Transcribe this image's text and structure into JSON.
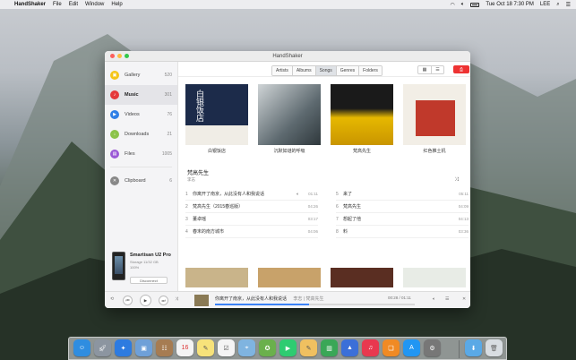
{
  "menubar": {
    "app_name": "HandShaker",
    "items": [
      "File",
      "Edit",
      "Window",
      "Help"
    ],
    "clock": "Tue Oct 18 7:30 PM",
    "user": "LEE"
  },
  "window": {
    "title": "HandShaker"
  },
  "sidebar": {
    "items": [
      {
        "label": "Gallery",
        "count": "520",
        "color": "#f5c518",
        "icon": "gallery-icon"
      },
      {
        "label": "Music",
        "count": "301",
        "color": "#e5383b",
        "icon": "music-icon"
      },
      {
        "label": "Videos",
        "count": "76",
        "color": "#2f7fe6",
        "icon": "video-icon"
      },
      {
        "label": "Downloads",
        "count": "21",
        "color": "#8bc34a",
        "icon": "download-icon"
      },
      {
        "label": "Files",
        "count": "1005",
        "color": "#9b59d6",
        "icon": "file-icon"
      },
      {
        "label": "Clipboard",
        "count": "6",
        "color": "#888888",
        "icon": "clipboard-icon"
      }
    ],
    "device": {
      "name": "Smartisan U2 Pro",
      "storage": "Storage 11/32 GB",
      "battery": "100%",
      "disconnect_label": "Disconnect"
    }
  },
  "toolbar": {
    "tabs": [
      "Artists",
      "Albums",
      "Songs",
      "Genres",
      "Folders"
    ],
    "active_tab": "Songs",
    "grid_icon": "grid-view-icon",
    "list_icon": "list-view-icon"
  },
  "albums": [
    {
      "title": "白银饭店",
      "color": "#1c2b4a"
    },
    {
      "title": "沉默如谜的呼吸",
      "color": "#6e7a80"
    },
    {
      "title": "梵高先生",
      "color": "#e6b800"
    },
    {
      "title": "红色推土机",
      "color": "#c0392b"
    }
  ],
  "detail": {
    "title": "梵高先生",
    "artist": "李志",
    "tracks": [
      {
        "num": "1",
        "name": "你离开了南京，从此没有人和我说话",
        "dur": "01:11"
      },
      {
        "num": "2",
        "name": "梵高先生（2015春巡版）",
        "dur": "04:26"
      },
      {
        "num": "3",
        "name": "董卓瑶",
        "dur": "03:17"
      },
      {
        "num": "4",
        "name": "春末的南方城市",
        "dur": "04:06"
      },
      {
        "num": "5",
        "name": "来了",
        "dur": "05:11"
      },
      {
        "num": "6",
        "name": "梵高先生",
        "dur": "04:09"
      },
      {
        "num": "7",
        "name": "想起了他",
        "dur": "04:13"
      },
      {
        "num": "8",
        "name": "料",
        "dur": "03:36"
      }
    ]
  },
  "player": {
    "title": "你离开了南京，从此没有人和我说话",
    "sub": "李志 | 梵高先生",
    "time": "00:28 / 01:11",
    "progress": 0.47
  }
}
